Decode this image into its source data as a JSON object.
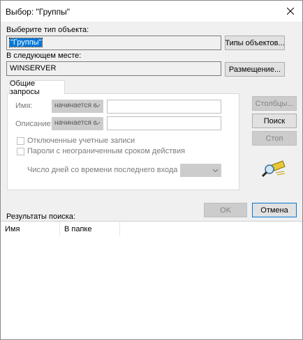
{
  "window": {
    "title": "Выбор: \"Группы\""
  },
  "object_type": {
    "label": "Выберите тип объекта:",
    "value": "\"Группы\"",
    "button": "Типы объектов..."
  },
  "location": {
    "label": "В следующем месте:",
    "value": "WINSERVER",
    "button": "Размещение..."
  },
  "tabs": [
    {
      "label": "Общие запросы"
    }
  ],
  "query": {
    "name_label": "Имя:",
    "name_combo": "начинается с",
    "desc_label": "Описание:",
    "desc_combo": "начинается с",
    "disabled_accounts": "Отключенные учетные записи",
    "no_expire_pw": "Пароли с неограниченным сроком действия",
    "days_label": "Число дней со времени последнего входа в систему:"
  },
  "side_buttons": {
    "columns": "Столбцы...",
    "find": "Поиск",
    "stop": "Стоп"
  },
  "footer": {
    "ok": "OK",
    "cancel": "Отмена"
  },
  "results": {
    "label": "Результаты поиска:",
    "columns": [
      "Имя",
      "В папке"
    ]
  },
  "colors": {
    "accent": "#0078d7",
    "window_bg": "#f0f0f0"
  }
}
